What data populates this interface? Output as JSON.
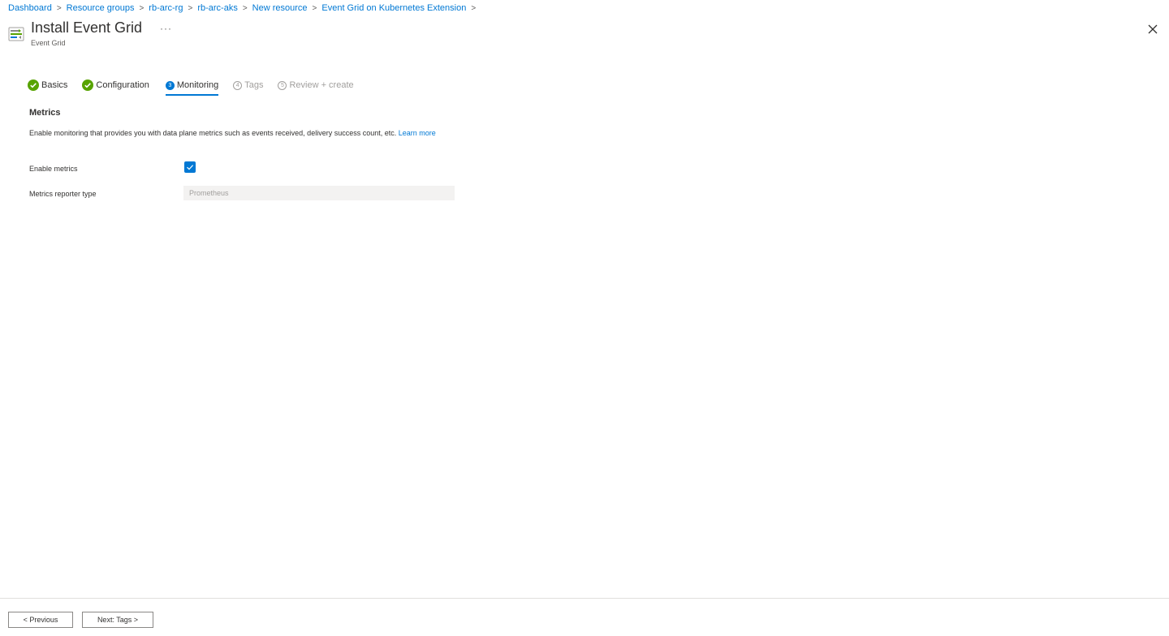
{
  "breadcrumb": [
    "Dashboard",
    "Resource groups",
    "rb-arc-rg",
    "rb-arc-aks",
    "New resource",
    "Event Grid on Kubernetes Extension"
  ],
  "header": {
    "title": "Install Event Grid",
    "subtitle": "Event Grid",
    "more_label": "···"
  },
  "tabs": [
    {
      "label": "Basics",
      "state": "done"
    },
    {
      "label": "Configuration",
      "state": "done"
    },
    {
      "label": "Monitoring",
      "state": "active",
      "number": "3"
    },
    {
      "label": "Tags",
      "state": "pending",
      "number": "4"
    },
    {
      "label": "Review + create",
      "state": "pending",
      "number": "5"
    }
  ],
  "section": {
    "title": "Metrics",
    "description": "Enable monitoring that provides you with data plane metrics such as events received, delivery success count, etc.",
    "learn_more": "Learn more"
  },
  "fields": {
    "enable_metrics_label": "Enable metrics",
    "enable_metrics_checked": true,
    "reporter_type_label": "Metrics reporter type",
    "reporter_type_value": "Prometheus"
  },
  "footer": {
    "previous_label": "< Previous",
    "next_label": "Next: Tags >"
  },
  "colors": {
    "accent": "#0078d4",
    "success": "#57a300",
    "disabled_text": "#a19f9d"
  }
}
